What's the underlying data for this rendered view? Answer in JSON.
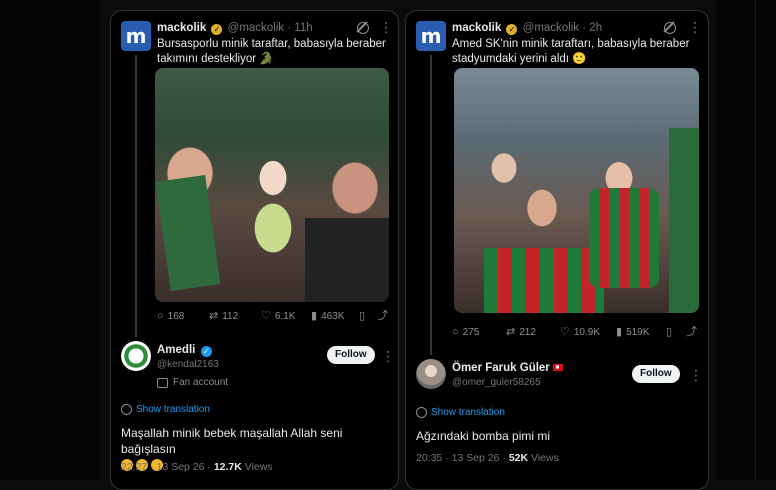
{
  "tweets": [
    {
      "author_name": "mackolik",
      "author_handle": "@mackolik",
      "time": "11h",
      "logo_letter": "m",
      "text_line1": "Bursasporlu minik taraftar, babasıyla beraber",
      "text_line2": "takımını destekliyor 🐊",
      "stats": {
        "replies": "168",
        "reposts": "112",
        "likes": "6.1K",
        "views": "463K"
      }
    },
    {
      "author_name": "mackolik",
      "author_handle": "@mackolik",
      "time": "2h",
      "logo_letter": "m",
      "text_line1": "Amed SK'nin minik taraftarı, babasıyla beraber",
      "text_line2": "stadyumdaki yerini aldı 🙂",
      "stats": {
        "replies": "275",
        "reposts": "212",
        "likes": "10.9K",
        "views": "519K"
      }
    }
  ],
  "replies": [
    {
      "name": "Amedli",
      "handle": "@kendal2163",
      "follow_label": "Follow",
      "fan_label": "Fan account",
      "translate_label": "Show translation",
      "text": "Maşallah minik bebek maşallah Allah seni bağışlasın",
      "date": "22:27 · 13 Sep 26 ·",
      "views_count": "12.7K",
      "views_label": "Views"
    },
    {
      "name": "Ömer Faruk Güler",
      "handle": "@omer_guler58265",
      "follow_label": "Follow",
      "translate_label": "Show translation",
      "text": "Ağzındaki bomba pimi mi",
      "date": "20:35 · 13 Sep 26 ·",
      "views_count": "52K",
      "views_label": "Views"
    }
  ],
  "colors": {
    "background": "#000000",
    "border": "#2f3336",
    "link": "#1d9bf0",
    "muted": "#71767b",
    "brand_logo": "#2a5db0",
    "gold_badge": "#e0b028",
    "blue_badge": "#1d9bf0"
  }
}
